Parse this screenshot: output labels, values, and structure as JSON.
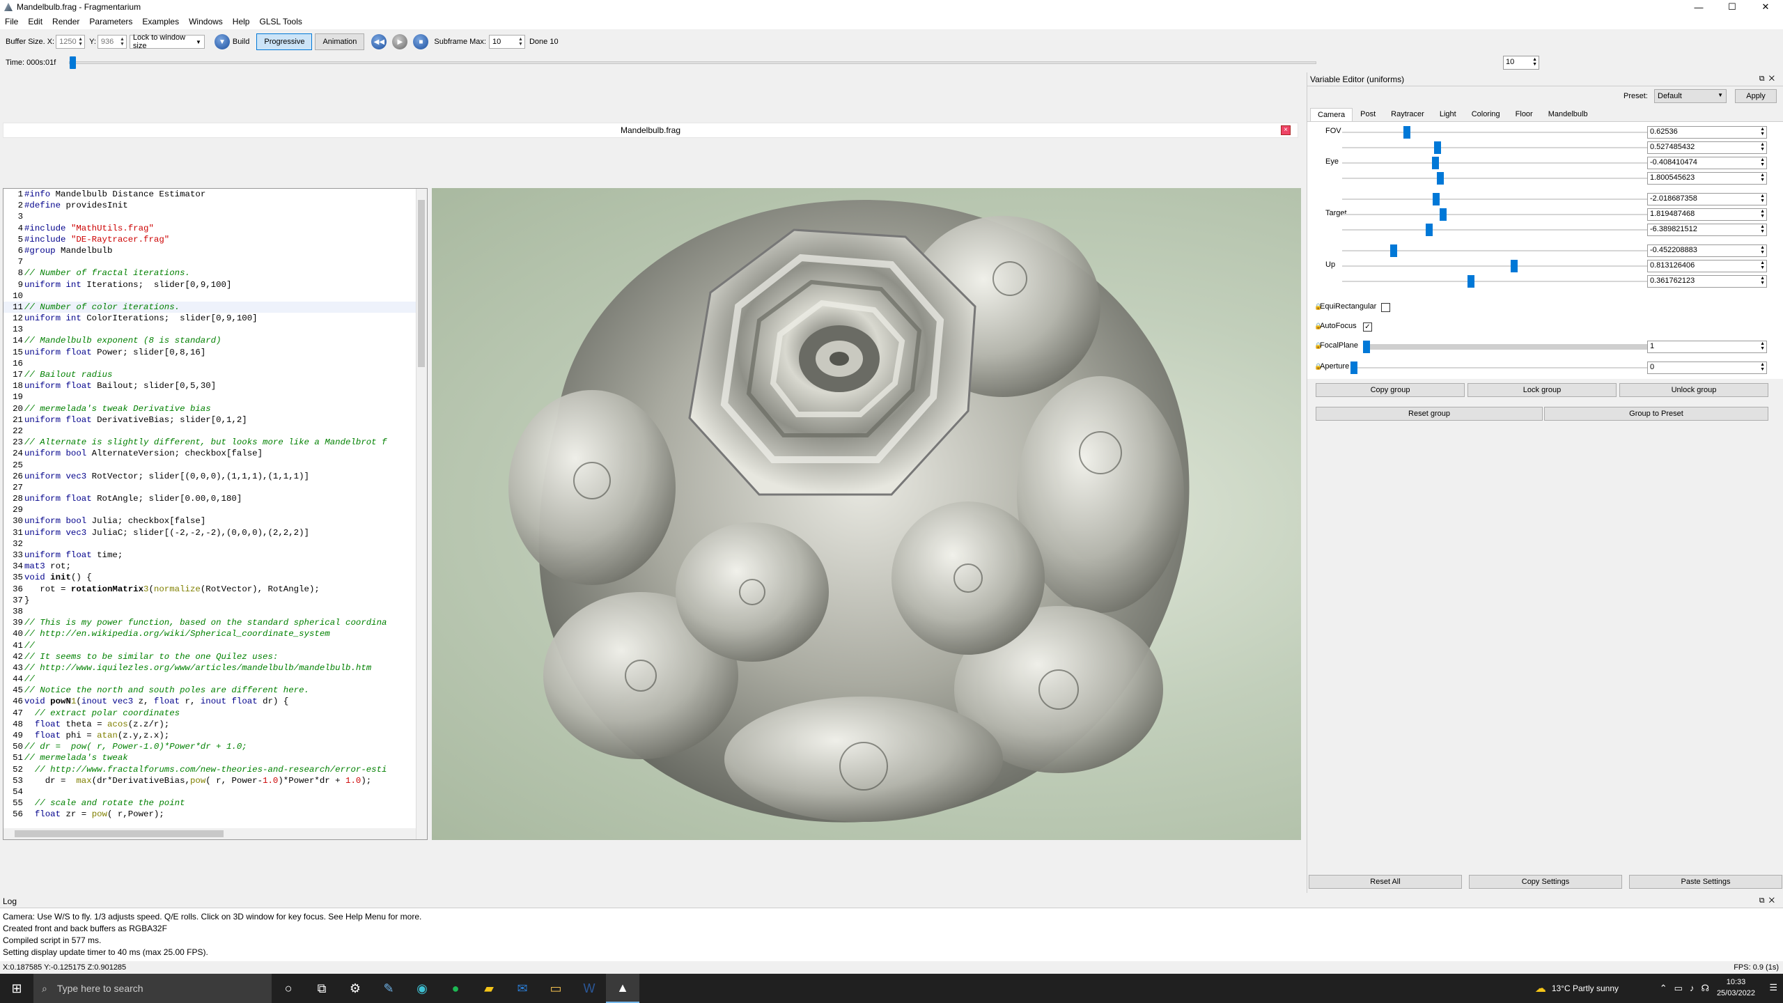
{
  "window": {
    "title": "Mandelbulb.frag - Fragmentarium",
    "controls": [
      "—",
      "☐",
      "✕"
    ]
  },
  "menu": [
    "File",
    "Edit",
    "Render",
    "Parameters",
    "Examples",
    "Windows",
    "Help",
    "GLSL Tools"
  ],
  "toolbar": {
    "buffer_label": "Buffer Size. X:",
    "buffer_x": "1250",
    "y_label": "Y:",
    "buffer_y": "936",
    "lock_mode": "Lock to window size",
    "build_label": "Build",
    "progressive_label": "Progressive",
    "animation_label": "Animation",
    "subframe_label": "Subframe Max:",
    "subframe_value": "10",
    "done_label": "Done 10"
  },
  "timeline": {
    "time_label": "Time: 000s:01f",
    "end_value": "10",
    "position": 0.0
  },
  "editor": {
    "tab_title": "Mandelbulb.frag",
    "lines": [
      {
        "n": "1",
        "parts": [
          [
            "kw",
            "#info"
          ],
          [
            "",
            " Mandelbulb Distance Estimator"
          ]
        ]
      },
      {
        "n": "2",
        "parts": [
          [
            "kw",
            "#define"
          ],
          [
            "",
            " providesInit"
          ]
        ]
      },
      {
        "n": "3",
        "parts": [
          [
            "",
            ""
          ]
        ]
      },
      {
        "n": "4",
        "parts": [
          [
            "kw",
            "#include"
          ],
          [
            "",
            " "
          ],
          [
            "str",
            "\"MathUtils.frag\""
          ]
        ]
      },
      {
        "n": "5",
        "parts": [
          [
            "kw",
            "#include"
          ],
          [
            "",
            " "
          ],
          [
            "str",
            "\"DE-Raytracer.frag\""
          ]
        ]
      },
      {
        "n": "6",
        "parts": [
          [
            "kw",
            "#group"
          ],
          [
            "",
            " Mandelbulb"
          ]
        ]
      },
      {
        "n": "7",
        "parts": [
          [
            "",
            ""
          ]
        ]
      },
      {
        "n": "8",
        "parts": [
          [
            "cm",
            "// Number of fractal iterations."
          ]
        ]
      },
      {
        "n": "9",
        "parts": [
          [
            "kw",
            "uniform int"
          ],
          [
            "",
            " Iterations;  slider[0,9,100]"
          ]
        ]
      },
      {
        "n": "10",
        "parts": [
          [
            "",
            ""
          ]
        ]
      },
      {
        "n": "11",
        "parts": [
          [
            "cm",
            "// Number of color iterations."
          ]
        ]
      },
      {
        "n": "12",
        "parts": [
          [
            "kw",
            "uniform int"
          ],
          [
            "",
            " ColorIterations;  slider[0,9,100]"
          ]
        ]
      },
      {
        "n": "13",
        "parts": [
          [
            "",
            ""
          ]
        ]
      },
      {
        "n": "14",
        "parts": [
          [
            "cm",
            "// Mandelbulb exponent (8 is standard)"
          ]
        ]
      },
      {
        "n": "15",
        "parts": [
          [
            "kw",
            "uniform float"
          ],
          [
            "",
            " Power; slider[0,8,16]"
          ]
        ]
      },
      {
        "n": "16",
        "parts": [
          [
            "",
            ""
          ]
        ]
      },
      {
        "n": "17",
        "parts": [
          [
            "cm",
            "// Bailout radius"
          ]
        ]
      },
      {
        "n": "18",
        "parts": [
          [
            "kw",
            "uniform float"
          ],
          [
            "",
            " Bailout; slider[0,5,30]"
          ]
        ]
      },
      {
        "n": "19",
        "parts": [
          [
            "",
            ""
          ]
        ]
      },
      {
        "n": "20",
        "parts": [
          [
            "cm",
            "// mermelada's tweak Derivative bias"
          ]
        ]
      },
      {
        "n": "21",
        "parts": [
          [
            "kw",
            "uniform float"
          ],
          [
            "",
            " DerivativeBias; slider[0,1,2]"
          ]
        ]
      },
      {
        "n": "22",
        "parts": [
          [
            "",
            ""
          ]
        ]
      },
      {
        "n": "23",
        "parts": [
          [
            "cm",
            "// Alternate is slightly different, but looks more like a Mandelbrot f"
          ]
        ]
      },
      {
        "n": "24",
        "parts": [
          [
            "kw",
            "uniform bool"
          ],
          [
            "",
            " AlternateVersion; checkbox[false]"
          ]
        ]
      },
      {
        "n": "25",
        "parts": [
          [
            "",
            ""
          ]
        ]
      },
      {
        "n": "26",
        "parts": [
          [
            "kw",
            "uniform vec3"
          ],
          [
            "",
            " RotVector; slider[(0,0,0),(1,1,1),(1,1,1)]"
          ]
        ]
      },
      {
        "n": "27",
        "parts": [
          [
            "",
            ""
          ]
        ]
      },
      {
        "n": "28",
        "parts": [
          [
            "kw",
            "uniform float"
          ],
          [
            "",
            " RotAngle; slider[0.00,0,180]"
          ]
        ]
      },
      {
        "n": "29",
        "parts": [
          [
            "",
            ""
          ]
        ]
      },
      {
        "n": "30",
        "parts": [
          [
            "kw",
            "uniform bool"
          ],
          [
            "",
            " Julia; checkbox[false]"
          ]
        ]
      },
      {
        "n": "31",
        "parts": [
          [
            "kw",
            "uniform vec3"
          ],
          [
            "",
            " JuliaC; slider[(-2,-2,-2),(0,0,0),(2,2,2)]"
          ]
        ]
      },
      {
        "n": "32",
        "parts": [
          [
            "",
            ""
          ]
        ]
      },
      {
        "n": "33",
        "parts": [
          [
            "kw",
            "uniform float"
          ],
          [
            "",
            " time;"
          ]
        ]
      },
      {
        "n": "34",
        "parts": [
          [
            "kw",
            "mat3"
          ],
          [
            "",
            " rot;"
          ]
        ]
      },
      {
        "n": "35",
        "parts": [
          [
            "kw",
            "void"
          ],
          [
            "fn",
            " init"
          ],
          [
            "",
            "() {"
          ]
        ]
      },
      {
        "n": "36",
        "parts": [
          [
            "",
            "   rot = "
          ],
          [
            "fn",
            "rotationMatrix"
          ],
          [
            "func",
            "3"
          ],
          [
            "",
            "("
          ],
          [
            "func",
            "normalize"
          ],
          [
            "",
            "(RotVector), RotAngle);"
          ]
        ]
      },
      {
        "n": "37",
        "parts": [
          [
            "",
            "}"
          ]
        ]
      },
      {
        "n": "38",
        "parts": [
          [
            "",
            ""
          ]
        ]
      },
      {
        "n": "39",
        "parts": [
          [
            "cm",
            "// This is my power function, based on the standard spherical coordina"
          ]
        ]
      },
      {
        "n": "40",
        "parts": [
          [
            "cm",
            "// http://en.wikipedia.org/wiki/Spherical_coordinate_system"
          ]
        ]
      },
      {
        "n": "41",
        "parts": [
          [
            "cm",
            "//"
          ]
        ]
      },
      {
        "n": "42",
        "parts": [
          [
            "cm",
            "// It seems to be similar to the one Quilez uses:"
          ]
        ]
      },
      {
        "n": "43",
        "parts": [
          [
            "cm",
            "// http://www.iquilezles.org/www/articles/mandelbulb/mandelbulb.htm"
          ]
        ]
      },
      {
        "n": "44",
        "parts": [
          [
            "cm",
            "//"
          ]
        ]
      },
      {
        "n": "45",
        "parts": [
          [
            "cm",
            "// Notice the north and south poles are different here."
          ]
        ]
      },
      {
        "n": "46",
        "parts": [
          [
            "kw",
            "void"
          ],
          [
            "fn",
            " powN"
          ],
          [
            "func",
            "1"
          ],
          [
            "",
            "("
          ],
          [
            "kw",
            "inout vec3"
          ],
          [
            "",
            " z, "
          ],
          [
            "kw",
            "float"
          ],
          [
            "",
            " r, "
          ],
          [
            "kw",
            "inout float"
          ],
          [
            "",
            " dr) {"
          ]
        ]
      },
      {
        "n": "47",
        "parts": [
          [
            "cm",
            "  // extract polar coordinates"
          ]
        ]
      },
      {
        "n": "48",
        "parts": [
          [
            "kw",
            "  float"
          ],
          [
            "",
            " theta = "
          ],
          [
            "func",
            "acos"
          ],
          [
            "",
            "(z.z/r);"
          ]
        ]
      },
      {
        "n": "49",
        "parts": [
          [
            "kw",
            "  float"
          ],
          [
            "",
            " phi = "
          ],
          [
            "func",
            "atan"
          ],
          [
            "",
            "(z.y,z.x);"
          ]
        ]
      },
      {
        "n": "50",
        "parts": [
          [
            "cm",
            "// dr =  pow( r, Power-1.0)*Power*dr + 1.0;"
          ]
        ]
      },
      {
        "n": "51",
        "parts": [
          [
            "cm",
            "// mermelada's tweak"
          ]
        ]
      },
      {
        "n": "52",
        "parts": [
          [
            "cm",
            "  // http://www.fractalforums.com/new-theories-and-research/error-esti"
          ]
        ]
      },
      {
        "n": "53",
        "parts": [
          [
            "",
            "    dr =  "
          ],
          [
            "func",
            "max"
          ],
          [
            "",
            "(dr*DerivativeBias,"
          ],
          [
            "func",
            "pow"
          ],
          [
            "",
            "( r, Power-"
          ],
          [
            "str",
            "1.0"
          ],
          [
            "",
            ")*Power*dr + "
          ],
          [
            "str",
            "1.0"
          ],
          [
            "",
            ");"
          ]
        ]
      },
      {
        "n": "54",
        "parts": [
          [
            "",
            ""
          ]
        ]
      },
      {
        "n": "55",
        "parts": [
          [
            "cm",
            "  // scale and rotate the point"
          ]
        ]
      },
      {
        "n": "56",
        "parts": [
          [
            "kw",
            "  float"
          ],
          [
            "",
            " zr = "
          ],
          [
            "func",
            "pow"
          ],
          [
            "",
            "( r,Power);"
          ]
        ]
      }
    ]
  },
  "variable_editor": {
    "title": "Variable Editor (uniforms)",
    "preset_label": "Preset:",
    "preset_value": "Default",
    "apply_label": "Apply",
    "tabs": [
      "Camera",
      "Post",
      "Raytracer",
      "Light",
      "Coloring",
      "Floor",
      "Mandelbulb"
    ],
    "rows": [
      {
        "label": "FOV",
        "value": "0.62536",
        "pos": 0.2
      },
      {
        "label": "",
        "value": "0.527485432",
        "pos": 0.3
      },
      {
        "label": "Eye",
        "value": "-0.408410474",
        "pos": 0.293
      },
      {
        "label": "",
        "value": "1.800545623",
        "pos": 0.31
      },
      {
        "label": "",
        "value": "-2.018687358",
        "pos": 0.295
      },
      {
        "label": "Target",
        "value": "1.819487468",
        "pos": 0.318
      },
      {
        "label": "",
        "value": "-6.389821512",
        "pos": 0.272
      },
      {
        "label": "",
        "value": "-0.452208883",
        "pos": 0.157
      },
      {
        "label": "Up",
        "value": "0.813126406",
        "pos": 0.55
      },
      {
        "label": "",
        "value": "0.361762123",
        "pos": 0.41
      }
    ],
    "equirect_label": "EquiRectangular",
    "equirect_checked": false,
    "autofocus_label": "AutoFocus",
    "autofocus_checked": true,
    "focalplane_label": "FocalPlane",
    "focalplane_value": "1",
    "aperture_label": "Aperture",
    "aperture_value": "0",
    "buttons": {
      "copy_group": "Copy group",
      "lock_group": "Lock group",
      "unlock_group": "Unlock group",
      "reset_group": "Reset group",
      "group_to_preset": "Group to Preset"
    },
    "bottom": {
      "reset_all": "Reset All",
      "copy_settings": "Copy Settings",
      "paste_settings": "Paste Settings"
    }
  },
  "log": {
    "title": "Log",
    "lines": [
      "Camera: Use W/S to fly. 1/3 adjusts speed. Q/E rolls. Click on 3D window for key focus. See Help Menu for more.",
      "Created front and back buffers as RGBA32F",
      "Compiled script in 577 ms.",
      "Setting display update timer to 40 ms (max 25.00 FPS)."
    ]
  },
  "status": {
    "coords": "X:0.187585 Y:-0.125175 Z:0.901285",
    "fps": "FPS: 0.9 (1s)"
  },
  "taskbar": {
    "search_placeholder": "Type here to search",
    "weather": "13°C  Partly sunny",
    "time": "10:33",
    "date": "25/03/2022"
  }
}
